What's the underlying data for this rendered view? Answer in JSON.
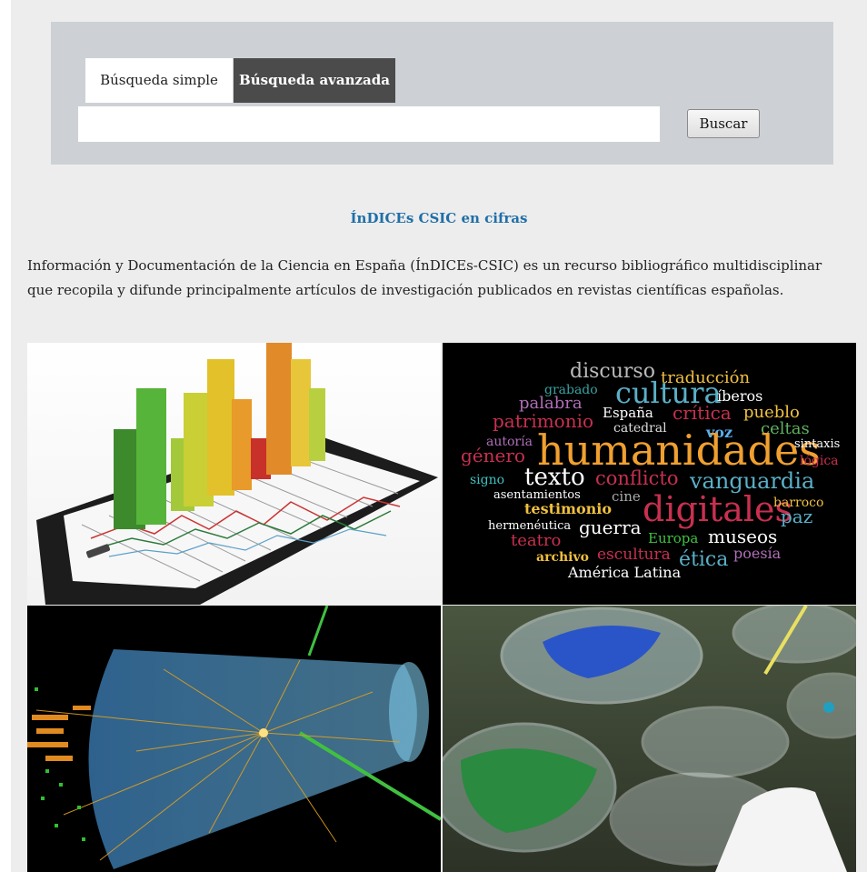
{
  "search": {
    "tabs": [
      {
        "label": "Búsqueda simple",
        "active": false
      },
      {
        "label": "Búsqueda avanzada",
        "active": true
      }
    ],
    "query": "",
    "button_label": "Buscar"
  },
  "section_title": "ÍnDICEs CSIC en cifras",
  "intro_text": "Información y Documentación de la Ciencia en España (ÍnDICEs-CSIC) es un recurso bibliográfico multidisciplinar que recopila y difunde principalmente artículos de investigación publicados en revistas científicas españolas.",
  "word_cloud": {
    "discurso": "discurso",
    "traduccion": "traducción",
    "grabado": "grabado",
    "palabra": "palabra",
    "cultura": "cultura",
    "iberos": "íberos",
    "patrimonio": "patrimonio",
    "espana": "España",
    "critica": "crítica",
    "pueblo": "pueblo",
    "catedral": "catedral",
    "voz": "voz",
    "celtas": "celtas",
    "autoria": "autoría",
    "humanidades": "humanidades",
    "sintaxis": "sintaxis",
    "genero": "género",
    "logica": "lógica",
    "signo": "signo",
    "texto": "texto",
    "conflicto": "conflicto",
    "vanguardia": "vanguardia",
    "asentamientos": "asentamientos",
    "cine": "cine",
    "testimonio": "testimonio",
    "digitales": "digitales",
    "barroco": "barroco",
    "hermeneutica": "hermenéutica",
    "guerra": "guerra",
    "paz": "paz",
    "teatro": "teatro",
    "europa": "Europa",
    "museos": "museos",
    "archivo": "archivo",
    "escultura": "escultura",
    "etica": "ética",
    "poesia": "poesía",
    "america_latina": "América Latina"
  },
  "colors": {
    "panel": "#cdd1d5",
    "active_tab": "#4b4b4b",
    "title": "#1f6fa8",
    "page_bg": "#ededed"
  }
}
